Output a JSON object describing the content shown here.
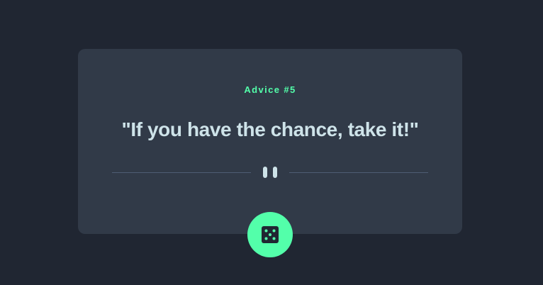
{
  "advice": {
    "label": "Advice #5",
    "quote": "\"If you have the chance, take it!\""
  },
  "colors": {
    "background": "#202632",
    "card": "#313a48",
    "accent": "#53ffaa",
    "quote_text": "#cee3e9",
    "divider": "#4f5d74"
  },
  "icons": {
    "divider_icon": "pause-icon",
    "button_icon": "dice-icon"
  }
}
